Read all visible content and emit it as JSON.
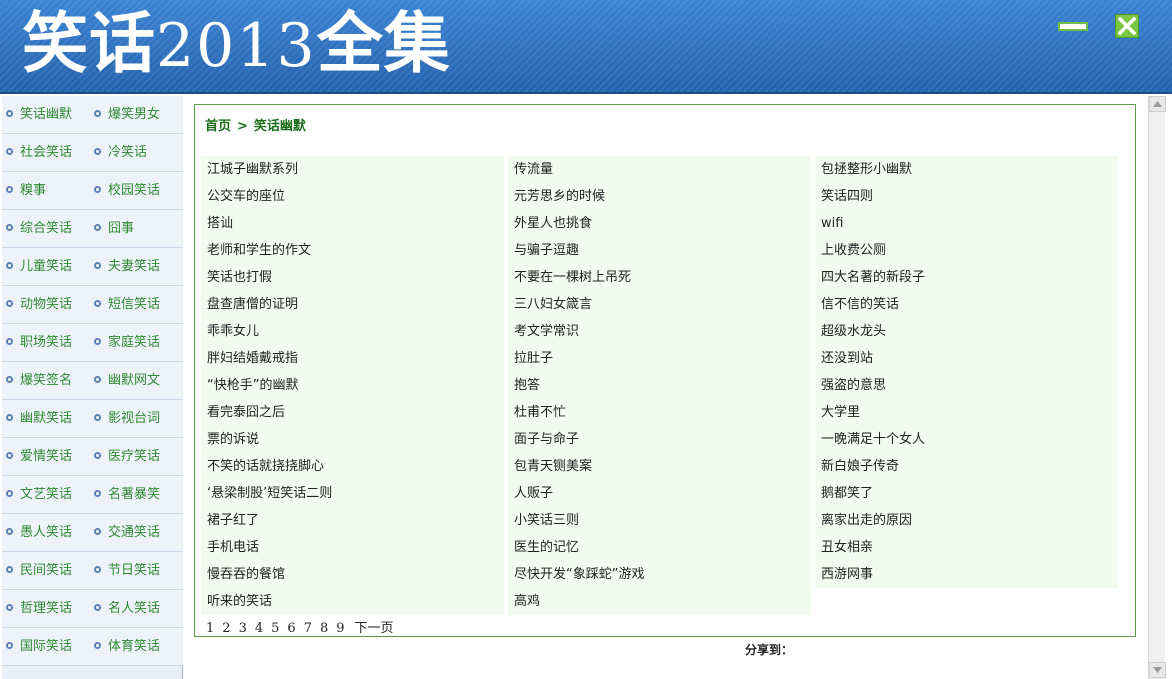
{
  "header": {
    "title_a": "笑话",
    "title_year": "2013",
    "title_b": "全集"
  },
  "window_controls": {
    "minimize": "minimize-icon",
    "close": "close-icon"
  },
  "sidebar": {
    "rows": [
      [
        "笑话幽默",
        "爆笑男女"
      ],
      [
        "社会笑话",
        "冷笑话"
      ],
      [
        "糗事",
        "校园笑话"
      ],
      [
        "综合笑话",
        "囧事"
      ],
      [
        "儿童笑话",
        "夫妻笑话"
      ],
      [
        "动物笑话",
        "短信笑话"
      ],
      [
        "职场笑话",
        "家庭笑话"
      ],
      [
        "爆笑签名",
        "幽默网文"
      ],
      [
        "幽默笑话",
        "影视台词"
      ],
      [
        "爱情笑话",
        "医疗笑话"
      ],
      [
        "文艺笑话",
        "名著暴笑"
      ],
      [
        "愚人笑话",
        "交通笑话"
      ],
      [
        "民间笑话",
        "节日笑话"
      ],
      [
        "哲理笑话",
        "名人笑话"
      ],
      [
        "国际笑话",
        "体育笑话"
      ]
    ]
  },
  "breadcrumb": {
    "home": "首页",
    "separator": ">",
    "current": "笑话幽默"
  },
  "articles": {
    "col1": [
      "江城子幽默系列",
      "公交车的座位",
      "搭讪",
      "老师和学生的作文",
      "笑话也打假",
      "盘查唐僧的证明",
      "乖乖女儿",
      "胖妇结婚戴戒指",
      "“快枪手”的幽默",
      "看完泰囧之后",
      "票的诉说",
      "不笑的话就挠挠脚心",
      "‘悬梁制股’短笑话二则",
      "裙子红了",
      "手机电话",
      "慢吞吞的餐馆",
      "听来的笑话"
    ],
    "col2": [
      "传流量",
      "元芳思乡的时候",
      "外星人也挑食",
      "与骗子逗趣",
      "不要在一棵树上吊死",
      "三八妇女箴言",
      "考文学常识",
      "拉肚子",
      "抱答",
      "杜甫不忙",
      "面子与命子",
      "包青天铡美案",
      "人贩子",
      "小笑话三则",
      "医生的记忆",
      "尽快开发“象踩蛇”游戏",
      "高鸡"
    ],
    "col3": [
      "包拯整形小幽默",
      "笑话四则",
      "wifi",
      "上收费公厕",
      "四大名著的新段子",
      "信不信的笑话",
      "超级水龙头",
      "还没到站",
      "强盗的意思",
      "大学里",
      "一晚满足十个女人",
      "新白娘子传奇",
      "鹅都笑了",
      "离家出走的原因",
      "丑女相亲",
      "西游网事"
    ]
  },
  "pager": {
    "pages": [
      "1",
      "2",
      "3",
      "4",
      "5",
      "6",
      "7",
      "8",
      "9"
    ],
    "next": "下一页"
  },
  "share_label": "分享到："
}
